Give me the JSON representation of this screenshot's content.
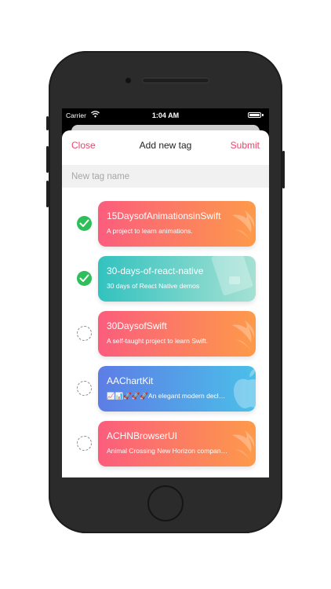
{
  "status_bar": {
    "carrier": "Carrier",
    "time": "1:04 AM"
  },
  "nav": {
    "close_label": "Close",
    "title": "Add new tag",
    "submit_label": "Submit"
  },
  "tag_input": {
    "placeholder": "New tag name",
    "value": ""
  },
  "colors": {
    "accent": "#e8436b",
    "check_green": "#2fbf5a"
  },
  "repos": [
    {
      "name": "15DaysofAnimationsinSwift",
      "description": "A project to learn animations.",
      "selected": true,
      "gradient": [
        "#fb5d7d",
        "#fd9a4a"
      ],
      "deco_icon": "swift-icon"
    },
    {
      "name": "30-days-of-react-native",
      "description": "30 days of React Native demos",
      "selected": true,
      "gradient": [
        "#33c2bf",
        "#a5e1d3"
      ],
      "deco_icon": "document-icon"
    },
    {
      "name": "30DaysofSwift",
      "description": "A self-taught project to learn Swift.",
      "selected": false,
      "gradient": [
        "#fb5d7d",
        "#fd9a4a"
      ],
      "deco_icon": "swift-icon"
    },
    {
      "name": "AAChartKit",
      "description": "📈📊🚀🚀🚀An elegant modern declarative data visualization chart framework",
      "selected": false,
      "gradient": [
        "#5d7de6",
        "#4bbfe8"
      ],
      "deco_icon": "apple-icon"
    },
    {
      "name": "ACHNBrowserUI",
      "description": "Animal Crossing New Horizon companion app in SwiftUI",
      "selected": false,
      "gradient": [
        "#fb5d7d",
        "#fd9a4a"
      ],
      "deco_icon": "swift-icon"
    }
  ]
}
